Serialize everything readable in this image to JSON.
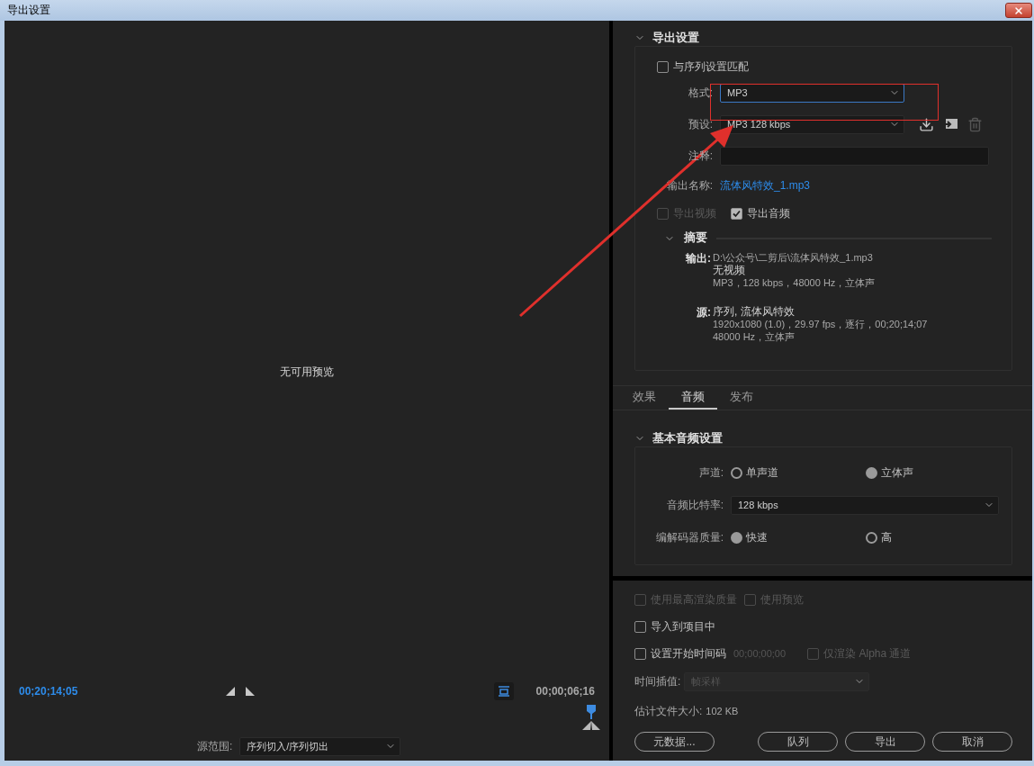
{
  "window": {
    "title": "导出设置"
  },
  "preview": {
    "message": "无可用预览",
    "current_time": "00;20;14;05",
    "duration": "00;00;06;16",
    "source_range": {
      "label": "源范围:",
      "value": "序列切入/序列切出"
    }
  },
  "export_settings": {
    "title": "导出设置",
    "expanded": true,
    "match_sequence": {
      "label": "与序列设置匹配",
      "checked": false
    },
    "format": {
      "label": "格式:",
      "value": "MP3",
      "focused": true
    },
    "preset": {
      "label": "预设:",
      "value": "MP3 128 kbps"
    },
    "comment": {
      "label": "注释:"
    },
    "output_name": {
      "label": "输出名称:",
      "value": "流体风特效_1.mp3"
    },
    "export_video": {
      "label": "导出视频",
      "checked": false,
      "disabled": true
    },
    "export_audio": {
      "label": "导出音频",
      "checked": true,
      "disabled": false
    },
    "summary": {
      "title": "摘要",
      "expanded": true,
      "output": {
        "label": "输出:",
        "lines": [
          "D:\\公众号\\二剪后\\流体风特效_1.mp3",
          "无视频",
          "MP3，128 kbps，48000 Hz，立体声"
        ]
      },
      "source": {
        "label": "源:",
        "lines": [
          "序列, 流体风特效",
          "1920x1080 (1.0)，29.97 fps，逐行，00;20;14;07",
          "48000 Hz，立体声"
        ]
      }
    }
  },
  "tabs": [
    {
      "label": "效果",
      "selected": false
    },
    {
      "label": "音频",
      "selected": true
    },
    {
      "label": "发布",
      "selected": false
    }
  ],
  "audio_settings": {
    "title": "基本音频设置",
    "expanded": true,
    "channels": {
      "label": "声道:",
      "options": [
        {
          "label": "单声道",
          "selected": false
        },
        {
          "label": "立体声",
          "selected": true
        }
      ]
    },
    "bitrate": {
      "label": "音频比特率:",
      "value": "128 kbps"
    },
    "codec_quality": {
      "label": "编解码器质量:",
      "options": [
        {
          "label": "快速",
          "selected": true
        },
        {
          "label": "高",
          "selected": false
        }
      ]
    }
  },
  "option_rows": [
    [
      {
        "kind": "checkbox",
        "label": "使用最高渲染质量",
        "checked": false,
        "disabled": true
      },
      {
        "kind": "checkbox",
        "label": "使用预览",
        "checked": false,
        "disabled": true
      }
    ],
    [
      {
        "kind": "checkbox",
        "label": "导入到项目中",
        "checked": false,
        "disabled": false
      }
    ],
    [
      {
        "kind": "checkbox",
        "label": "设置开始时间码",
        "checked": false,
        "disabled": false
      },
      {
        "kind": "timecode",
        "value": "00;00;00;00",
        "disabled": true
      },
      {
        "kind": "checkbox",
        "label": "仅渲染 Alpha 通道",
        "checked": false,
        "disabled": true
      }
    ]
  ],
  "time_interpolation": {
    "label": "时间插值:",
    "value": "帧采样",
    "disabled": true
  },
  "file_size": {
    "label": "估计文件大小:",
    "value": "102 KB"
  },
  "buttons": [
    {
      "label": "元数据..."
    },
    {
      "label": "队列"
    },
    {
      "label": "导出"
    },
    {
      "label": "取消"
    }
  ]
}
